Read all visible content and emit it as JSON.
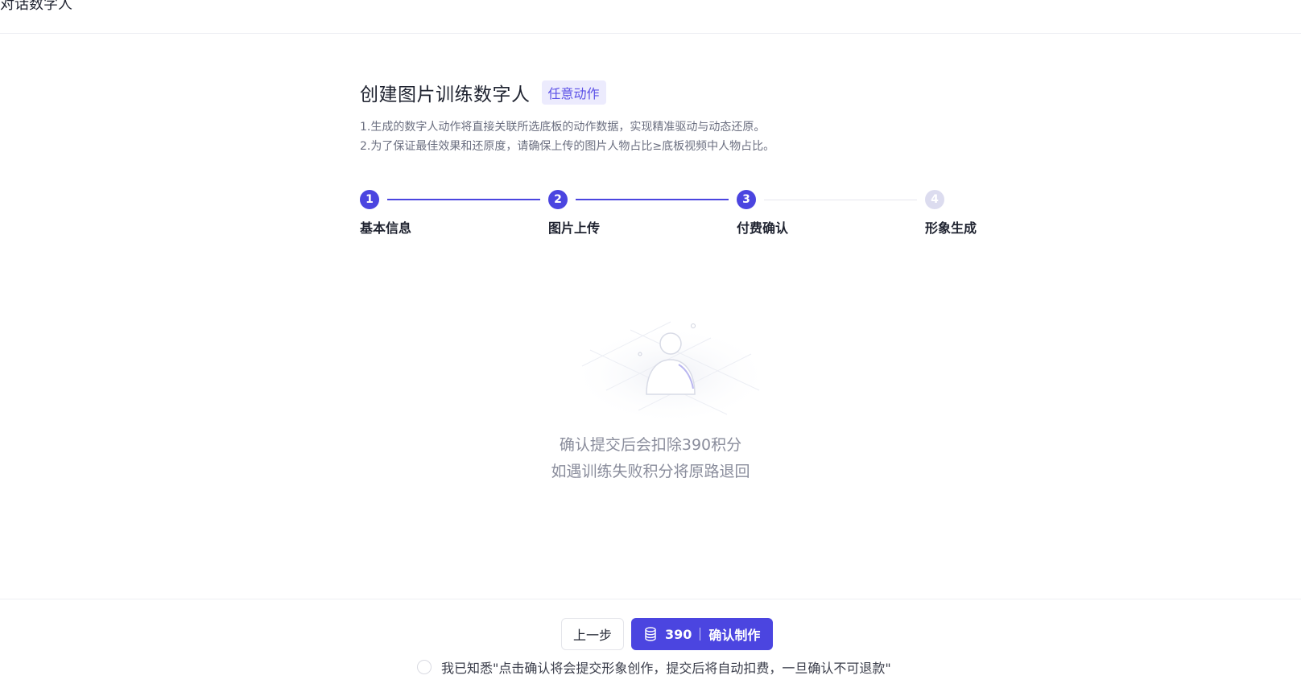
{
  "header": {
    "title": "对话数字人"
  },
  "main": {
    "title": "创建图片训练数字人",
    "tag": "任意动作",
    "notes": [
      "1.生成的数字人动作将直接关联所选底板的动作数据，实现精准驱动与动态还原。",
      "2.为了保证最佳效果和还原度，请确保上传的图片人物占比≥底板视频中人物占比。"
    ]
  },
  "stepper": {
    "steps": [
      {
        "number": "1",
        "label": "基本信息"
      },
      {
        "number": "2",
        "label": "图片上传"
      },
      {
        "number": "3",
        "label": "付费确认"
      },
      {
        "number": "4",
        "label": "形象生成"
      }
    ],
    "current_step": 3
  },
  "info": {
    "line1": "确认提交后会扣除390积分",
    "line2": "如遇训练失败积分将原路退回"
  },
  "footer": {
    "prev_label": "上一步",
    "cost": "390",
    "confirm_label": "确认制作",
    "agreement": "我已知悉\"点击确认将会提交形象创作，提交后将自动扣费，一旦确认不可退款\""
  },
  "colors": {
    "accent": "#4b45e0",
    "tag_bg": "#ecebfd",
    "inactive_step": "#dcdcef"
  },
  "icons": {
    "placeholder": "person-placeholder-icon",
    "cost": "coin-stack-icon"
  }
}
